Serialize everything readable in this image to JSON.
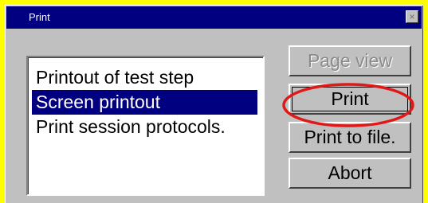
{
  "window": {
    "title": "Print",
    "close_glyph": "×"
  },
  "list": {
    "items": [
      {
        "label": "Printout of test step",
        "selected": false
      },
      {
        "label": "Screen printout",
        "selected": true
      },
      {
        "label": "Print session protocols.",
        "selected": false
      }
    ]
  },
  "buttons": {
    "page_view": "Page view",
    "print": "Print",
    "print_to_file": "Print to file.",
    "abort": "Abort"
  },
  "colors": {
    "background": "#ffff00",
    "dialog": "#c0c0c0",
    "titlebar": "#000080",
    "selection": "#000080",
    "highlight_ring": "#e01818"
  },
  "icons": {
    "close": "close-icon"
  }
}
